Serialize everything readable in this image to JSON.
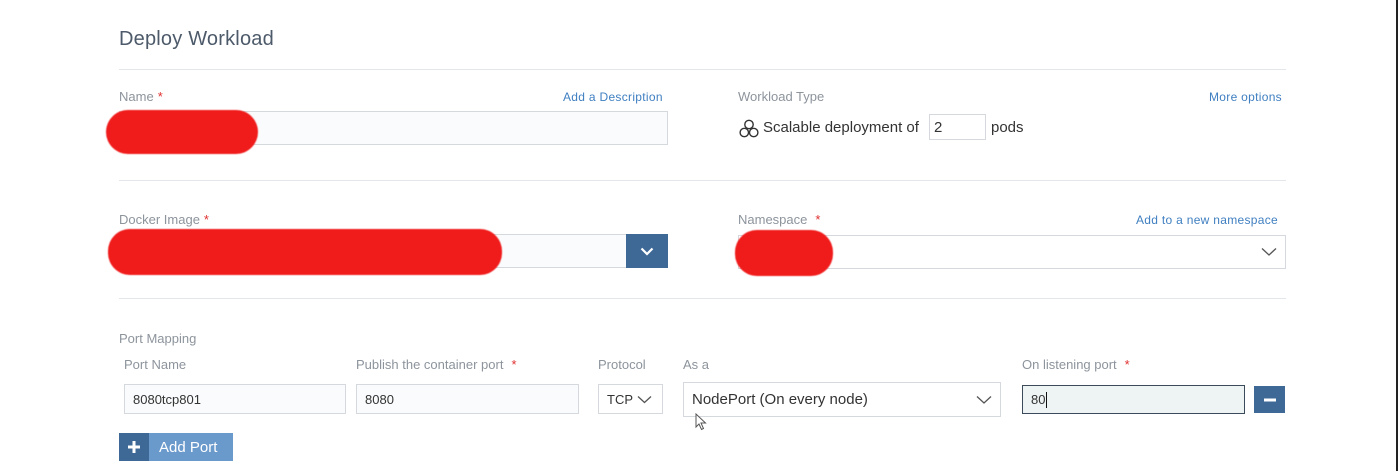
{
  "page": {
    "title": "Deploy Workload"
  },
  "name_field": {
    "label": "Name",
    "required": "*",
    "link": "Add a Description",
    "value": ""
  },
  "workload": {
    "label": "Workload Type",
    "more_link": "More options",
    "prefix": "Scalable deployment of",
    "pods_value": "2",
    "suffix": "pods"
  },
  "image_field": {
    "label": "Docker Image",
    "required": "*",
    "value": ""
  },
  "namespace_field": {
    "label": "Namespace",
    "required": "*",
    "link": "Add to a new namespace",
    "value": ""
  },
  "ports": {
    "section_label": "Port Mapping",
    "col_port_name": "Port Name",
    "col_publish": "Publish the container port",
    "col_protocol": "Protocol",
    "col_as": "As a",
    "col_listen": "On listening port",
    "required": "*",
    "rows": [
      {
        "port_name": "8080tcp801",
        "container_port": "8080",
        "protocol": "TCP",
        "service_type": "NodePort (On every node)",
        "listen_port": "80"
      }
    ],
    "add_label": "Add Port"
  },
  "colors": {
    "accent": "#3e6996",
    "accent_light": "#6a99cc",
    "required": "#e0302f",
    "link": "#3f7fc1",
    "redaction": "#f01b1b"
  },
  "icons": {
    "workload": "cluster-icon",
    "dropdown": "chevron-down-icon",
    "add": "plus-icon",
    "remove": "minus-icon",
    "cursor": "mouse-cursor-icon"
  }
}
